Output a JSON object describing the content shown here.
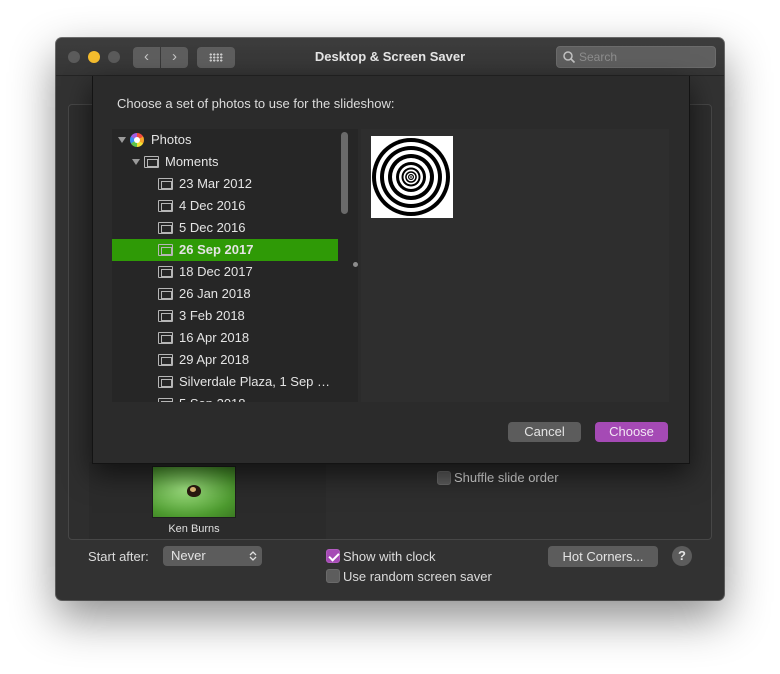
{
  "window": {
    "title": "Desktop & Screen Saver",
    "search_placeholder": "Search"
  },
  "sheet": {
    "prompt": "Choose a set of photos to use for the slideshow:",
    "tree": {
      "root": "Photos",
      "group": "Moments",
      "items": [
        "23 Mar 2012",
        "4 Dec 2016",
        "5 Dec 2016",
        "26 Sep 2017",
        "18 Dec 2017",
        "26 Jan 2018",
        "3 Feb 2018",
        "16 Apr 2018",
        "29 Apr 2018",
        "Silverdale Plaza, 1 Sep 2...",
        "5 Sep 2018"
      ],
      "selected": "26 Sep 2017"
    },
    "cancel_label": "Cancel",
    "choose_label": "Choose"
  },
  "screen_saver": {
    "current_name": "Ken Burns",
    "shuffle_label": "Shuffle slide order",
    "shuffle_checked": false
  },
  "bottom": {
    "start_after_label": "Start after:",
    "start_after_value": "Never",
    "show_clock_label": "Show with clock",
    "show_clock_checked": true,
    "random_label": "Use random screen saver",
    "random_checked": false,
    "hot_corners_label": "Hot Corners...",
    "help_label": "?"
  },
  "colors": {
    "selection": "#2f9a06",
    "accent": "#a54ab5",
    "minimize": "#f5bd2e"
  }
}
